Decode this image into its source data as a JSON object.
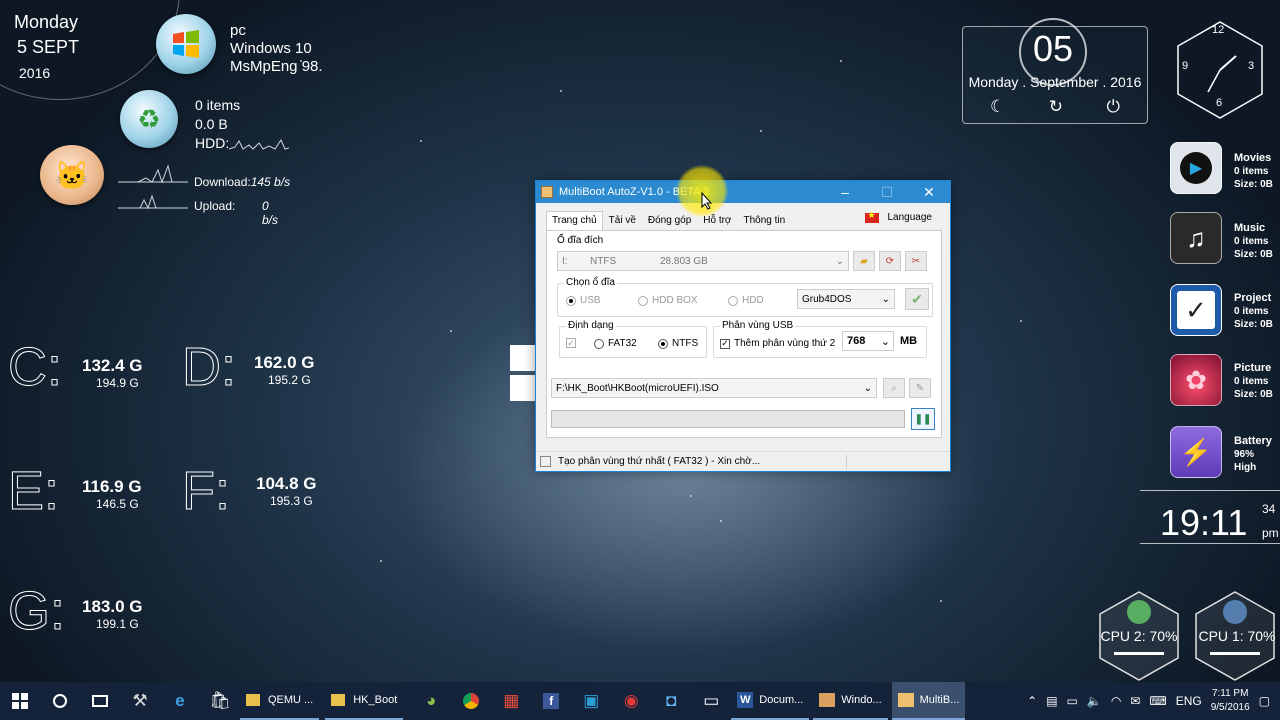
{
  "date_widget": {
    "day": "Monday",
    "date": "5 SEPT",
    "year": "2016"
  },
  "system": {
    "name": "pc",
    "os": "Windows 10",
    "proc": "MsMpEng 98."
  },
  "recycle": {
    "items": "0 items",
    "size": "0.0 B",
    "hdd": "HDD:"
  },
  "network": {
    "download_label": "Download:",
    "download_value": "145 b/s",
    "upload_label": "Upload:",
    "upload_value": "0 b/s"
  },
  "drives": [
    {
      "letter": "C:",
      "used": "132.4 G",
      "total": "194.9 G"
    },
    {
      "letter": "D:",
      "used": "162.0 G",
      "total": "195.2 G"
    },
    {
      "letter": "E:",
      "used": "116.9 G",
      "total": "146.5 G"
    },
    {
      "letter": "F:",
      "used": "104.8 G",
      "total": "195.3 G"
    },
    {
      "letter": "G:",
      "used": "183.0 G",
      "total": "199.1 G"
    }
  ],
  "clock_widget": {
    "day_num": "05",
    "full_date": "Monday . September . 2016"
  },
  "analog_clock": {
    "n12": "12",
    "n3": "3",
    "n6": "6",
    "n9": "9"
  },
  "dock": [
    {
      "title": "Movies",
      "l1": "0 items",
      "l2": "Size: 0B",
      "icon": "play-icon"
    },
    {
      "title": "Music",
      "l1": "0 items",
      "l2": "Size: 0B",
      "icon": "music-icon"
    },
    {
      "title": "Project",
      "l1": "0 items",
      "l2": "Size: 0B",
      "icon": "check-icon"
    },
    {
      "title": "Picture",
      "l1": "0 items",
      "l2": "Size: 0B",
      "icon": "picture-icon"
    },
    {
      "title": "Battery",
      "l1": "96%",
      "l2": "High",
      "icon": "battery-icon"
    }
  ],
  "big_clock": {
    "time": "19:11",
    "side1": "34",
    "side2": "pm"
  },
  "cpu": {
    "cpu2": "CPU 2: 70%",
    "cpu1": "CPU 1: 70%"
  },
  "window": {
    "title": "MultiBoot AutoZ-V1.0 - BETA 2",
    "tabs": [
      "Trang chủ",
      "Tải về",
      "Đóng góp",
      "Hỗ trợ",
      "Thông tin"
    ],
    "language": "Language",
    "dest_group": "Ổ đĩa đích",
    "drive_letter": "I:",
    "drive_fs": "NTFS",
    "drive_size": "28.803  GB",
    "select_group": "Chọn ổ đĩa",
    "opt_usb": "USB",
    "opt_hddbox": "HDD BOX",
    "opt_hdd": "HDD",
    "bootloader": "Grub4DOS",
    "format_group": "Định dạng",
    "fat32": "FAT32",
    "ntfs": "NTFS",
    "partition_group": "Phân vùng USB",
    "partition_check": "Thêm phân vùng thứ 2",
    "partition_size": "768",
    "partition_unit": "MB",
    "iso_path": "F:\\HK_Boot\\HKBoot(microUEFI).ISO",
    "status": "Tạo phân vùng thứ nhất ( FAT32 ) - Xin chờ..."
  },
  "taskbar": {
    "apps": [
      {
        "label": "QEMU ...",
        "icon": "folder-icon"
      },
      {
        "label": "HK_Boot",
        "icon": "folder-icon"
      },
      {
        "label": "Docum...",
        "icon": "word-icon"
      },
      {
        "label": "Windo...",
        "icon": "media-icon"
      },
      {
        "label": "MultiB...",
        "icon": "app-icon"
      }
    ],
    "lang": "ENG",
    "time": "7:11 PM",
    "date": "9/5/2016"
  }
}
